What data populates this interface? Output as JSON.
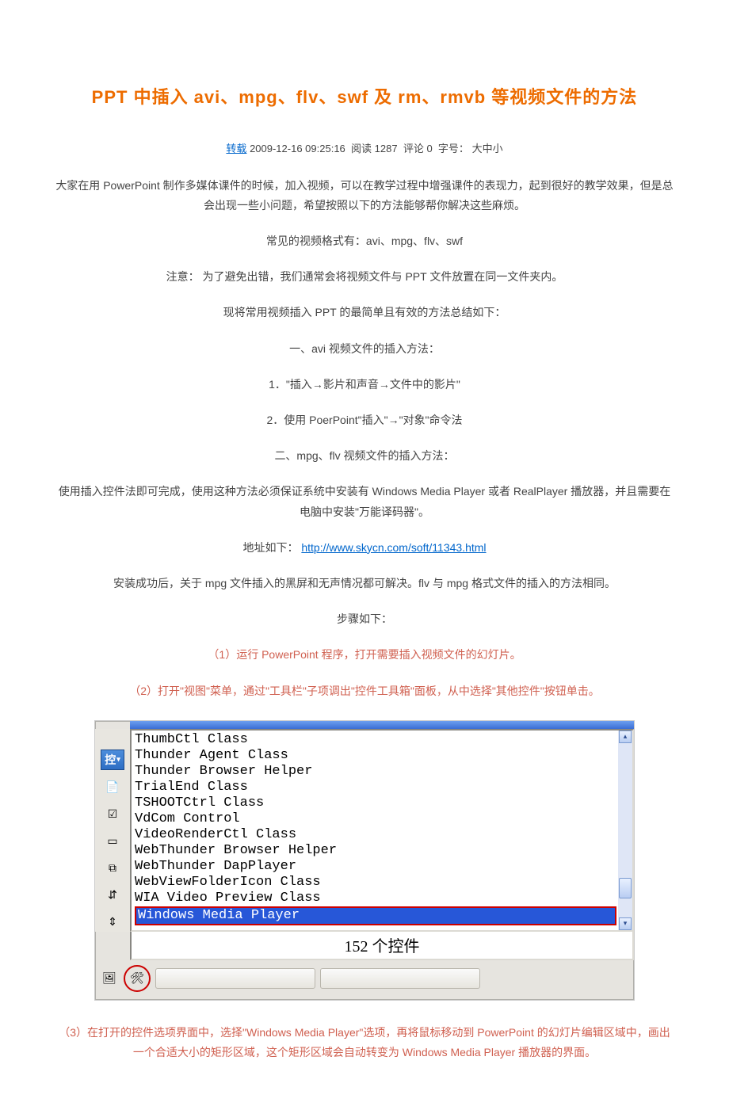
{
  "title": "PPT 中插入 avi、mpg、flv、swf 及 rm、rmvb 等视频文件的方法",
  "meta": {
    "zhuanzai_label": "转载",
    "datetime": "2009-12-16 09:25:16",
    "read_label": "阅读",
    "read_count": "1287",
    "comment_label": "评论",
    "comment_count": "0",
    "fontsize_label": "字号：",
    "fontsize_value": "大中小"
  },
  "paras": {
    "p1": "大家在用 PowerPoint 制作多媒体课件的时候，加入视频，可以在教学过程中增强课件的表现力，起到很好的教学效果，但是总会出现一些小问题，希望按照以下的方法能够帮你解决这些麻烦。",
    "p2": "常见的视频格式有：avi、mpg、flv、swf",
    "p3": "注意：  为了避免出错，我们通常会将视频文件与 PPT 文件放置在同一文件夹内。",
    "p4": "现将常用视频插入 PPT 的最简单且有效的方法总结如下：",
    "p5": "一、avi 视频文件的插入方法：",
    "p6": "1．\"插入→影片和声音→文件中的影片\"",
    "p7": "2．使用 PoerPoint\"插入\"→\"对象\"命令法",
    "p8": "二、mpg、flv 视频文件的插入方法：",
    "p9": "使用插入控件法即可完成，使用这种方法必须保证系统中安装有 Windows Media Player 或者 RealPlayer 播放器，并且需要在电脑中安装\"万能译码器\"。",
    "p10_prefix": "地址如下：",
    "p10_link": "http://www.skycn.com/soft/11343.html",
    "p11": "安装成功后，关于 mpg 文件插入的黑屏和无声情况都可解决。flv 与 mpg 格式文件的插入的方法相同。",
    "p12": "步骤如下：",
    "p13": "（1）运行 PowerPoint 程序，打开需要插入视频文件的幻灯片。",
    "p14": "（2）打开\"视图\"菜单，通过\"工具栏\"子项调出\"控件工具箱\"面板，从中选择\"其他控件\"按钮单击。",
    "p15": "（3）在打开的控件选项界面中，选择\"Windows Media Player\"选项，再将鼠标移动到 PowerPoint 的幻灯片编辑区域中，画出一个合适大小的矩形区域，这个矩形区域会自动转变为 Windows Media Player 播放器的界面。"
  },
  "controls": {
    "toolbar_kong": "控",
    "list": [
      "ThumbCtl Class",
      "Thunder Agent Class",
      "Thunder Browser Helper",
      "TrialEnd Class",
      "TSHOOTCtrl Class",
      "VdCom Control",
      "VideoRenderCtl Class",
      "WebThunder Browser Helper",
      "WebThunder DapPlayer",
      "WebViewFolderIcon Class",
      "WIA Video Preview Class",
      "Windows Media Player"
    ],
    "selected_index": 11,
    "count_text": "152 个控件"
  }
}
